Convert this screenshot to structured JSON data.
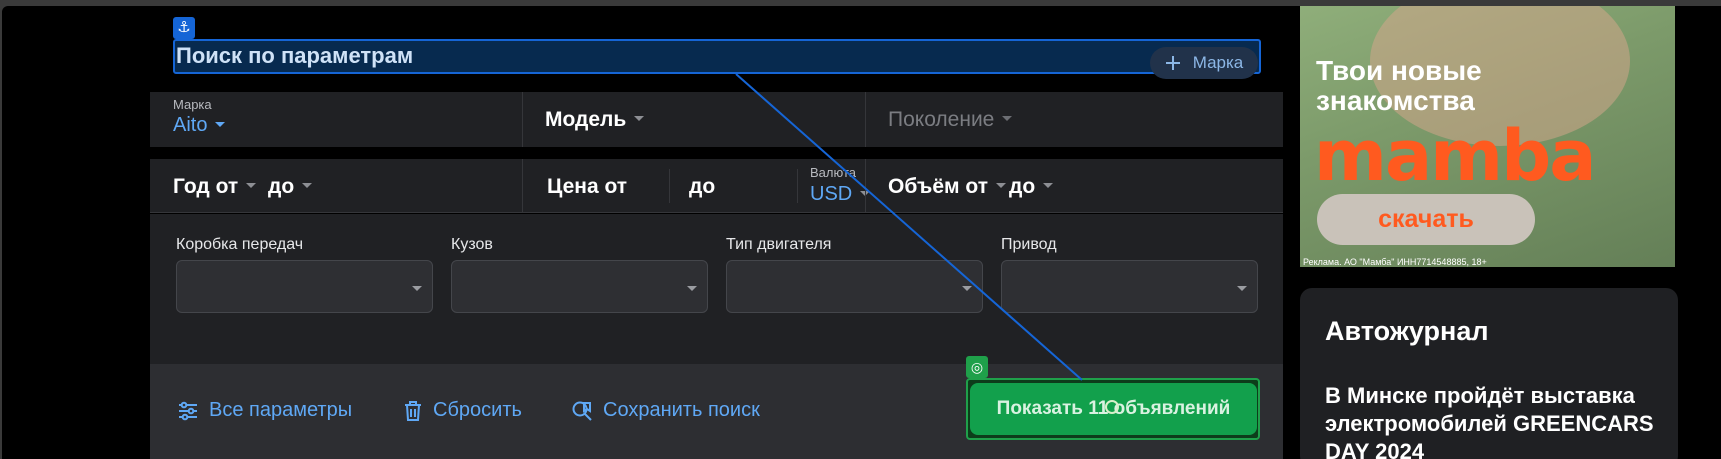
{
  "header": {
    "title": "Поиск по параметрам",
    "brand_button": "Марка",
    "anchor_icon": "⚓"
  },
  "row1": {
    "brand_label": "Марка",
    "brand_value": "Aito",
    "model": "Модель",
    "generation": "Поколение"
  },
  "row2": {
    "year_from": "Год от",
    "year_to": "до",
    "price_from": "Цена от",
    "price_to": "до",
    "currency_label": "Валюта",
    "currency_value": "USD",
    "volume_from": "Объём от",
    "volume_to": "до"
  },
  "filters": [
    {
      "label": "Коробка передач"
    },
    {
      "label": "Кузов"
    },
    {
      "label": "Тип двигателя"
    },
    {
      "label": "Привод"
    }
  ],
  "actions": {
    "all_params": "Все параметры",
    "reset": "Сбросить",
    "save_search": "Сохранить поиск",
    "show": "Показать 11 объявлений"
  },
  "ad": {
    "headline_line1": "Твои новые",
    "headline_line2": "знакомства",
    "logo": "mamba",
    "button": "скачать",
    "disclaimer": "Реклама. АО \"Мамба\" ИНН7714548885, 18+"
  },
  "journal": {
    "title": "Автожурнал",
    "article": "В Минске пройдёт выставка электромобилей GREENCARS DAY 2024"
  },
  "colors": {
    "accent_blue": "#5fa8f5",
    "show_button": "#12a04c",
    "highlight": "#1565d6"
  }
}
